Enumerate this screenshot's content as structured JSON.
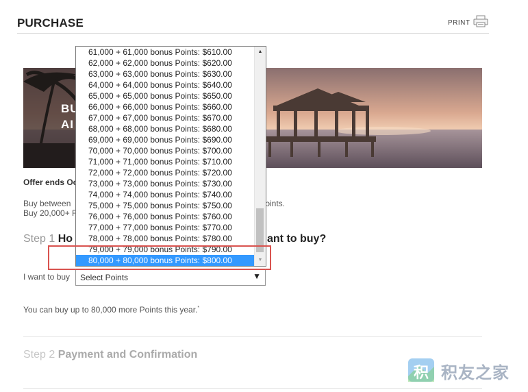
{
  "header": {
    "title": "PURCHASE",
    "print_label": "PRINT"
  },
  "banner": {
    "line1": "BU",
    "line2": "AI"
  },
  "offer": {
    "ends_text": "Offer ends Oc",
    "buy_line_1": "Buy between",
    "buy_line_1_end": "s Points.",
    "buy_line_2": "Buy 20,000+ F"
  },
  "step1": {
    "number": "Step 1",
    "title_start": "Ho",
    "title_end": "ant to buy?"
  },
  "form": {
    "want_label": "I want to buy",
    "select_value": "Select Points",
    "select_arrow": "▼",
    "limit_note": "You can buy up to 80,000 more Points this year.",
    "limit_mark": "*"
  },
  "dropdown": {
    "scroll_up": "▲",
    "scroll_down": "▼",
    "selected_index": 19,
    "options": [
      "61,000 + 61,000 bonus Points: $610.00",
      "62,000 + 62,000 bonus Points: $620.00",
      "63,000 + 63,000 bonus Points: $630.00",
      "64,000 + 64,000 bonus Points: $640.00",
      "65,000 + 65,000 bonus Points: $650.00",
      "66,000 + 66,000 bonus Points: $660.00",
      "67,000 + 67,000 bonus Points: $670.00",
      "68,000 + 68,000 bonus Points: $680.00",
      "69,000 + 69,000 bonus Points: $690.00",
      "70,000 + 70,000 bonus Points: $700.00",
      "71,000 + 71,000 bonus Points: $710.00",
      "72,000 + 72,000 bonus Points: $720.00",
      "73,000 + 73,000 bonus Points: $730.00",
      "74,000 + 74,000 bonus Points: $740.00",
      "75,000 + 75,000 bonus Points: $750.00",
      "76,000 + 76,000 bonus Points: $760.00",
      "77,000 + 77,000 bonus Points: $770.00",
      "78,000 + 78,000 bonus Points: $780.00",
      "79,000 + 79,000 bonus Points: $790.00",
      "80,000 + 80,000 bonus Points: $800.00"
    ]
  },
  "step2": {
    "number": "Step 2",
    "title": "Payment and Confirmation"
  },
  "watermark": {
    "text": "积友之家"
  },
  "colors": {
    "selection": "#3399ff",
    "highlight_border": "#d9534f",
    "rule": "#d5d5d5"
  },
  "icons": {
    "print": "printer-icon"
  }
}
